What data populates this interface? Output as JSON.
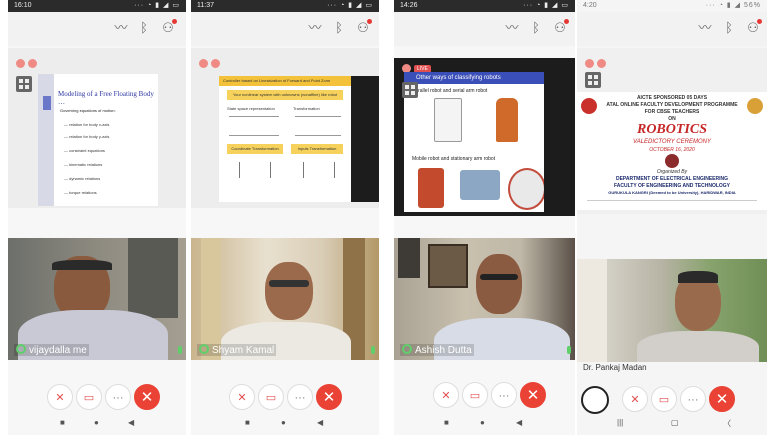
{
  "panels": [
    {
      "time": "16:10",
      "status_icons": "··· ◔ ▮ ◢ ▭",
      "slide": {
        "title": "Modeling of a Free Floating Body …",
        "bullets": [
          "Governing equations of motion:",
          "— relation for body x-axis",
          "— relation for body y-axis",
          "— constraint equations",
          "— kinematic relations",
          "— dynamic relations",
          "— torque relations"
        ]
      },
      "participant": "vijaydalla me"
    },
    {
      "time": "11:37",
      "status_icons": "··· ◔ ▮ ◢ ▭",
      "slide": {
        "title": "Controller based on Linearization of Forward and Point Zone",
        "box1": "Your nonlinear system with unknowns (nonaffine) like robot",
        "left_head": "State space representation",
        "right_head": "Transformation",
        "bar_left": "Coordinate Transformation",
        "bar_right": "Inputs Transformation"
      },
      "participant": "Shyam Kamal"
    },
    {
      "time": "14:26",
      "status_icons": "··· ◔ ▮ ◢ ▭",
      "live": "LIVE",
      "slide": {
        "title": "Other ways of classifying robots",
        "item1": "Parallel robot and serial arm robot",
        "item2": "Mobile robot and stationary arm robot"
      },
      "participant": "Ashish Dutta"
    },
    {
      "time": "4:20",
      "status_icons": "··· ◔ ▮ ◢ 56%",
      "slide": {
        "line1": "AICTE SPONSORED 05 DAYS",
        "line2": "ATAL ONLINE FACULTY DEVELOPMENT PROGRAMME",
        "line3": "FOR CBSE TEACHERS",
        "line4": "ON",
        "topic": "ROBOTICS",
        "ceremony": "VALEDICTORY CEREMONY",
        "date": "OCTOBER 16, 2020",
        "organized": "Organized By",
        "dept1": "DEPARTMENT OF ELECTRICAL ENGINEERING",
        "dept2": "FACULTY OF ENGINEERING AND TECHNOLOGY",
        "univ": "GURUKULA KANGRI (Deemed to be University), HARIDWAR, INDIA"
      },
      "participant": "Dr. Pankaj Madan"
    }
  ],
  "icons": {
    "wave": "〰",
    "bluetooth": "ᛒ",
    "person": "⚇"
  },
  "colors": {
    "end_call": "#ea4335",
    "active_speaker": "#5fcf6a",
    "dot": "#f08a84"
  }
}
